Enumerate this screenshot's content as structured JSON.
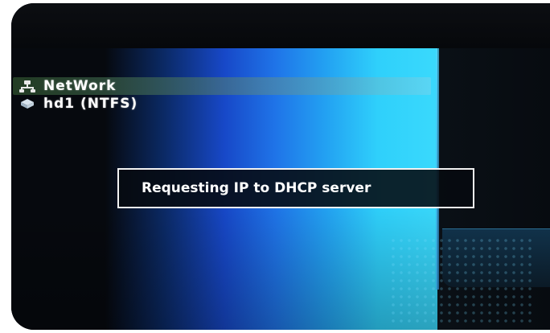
{
  "menu": {
    "items": [
      {
        "label": "NetWork",
        "icon": "network-icon",
        "selected": true
      },
      {
        "label": "hd1 (NTFS)",
        "icon": "hard-drive-icon",
        "selected": false
      }
    ]
  },
  "dialog": {
    "message": "Requesting IP to DHCP server"
  },
  "colors": {
    "background": "#07090d",
    "gradient_mid": "#1f74e8",
    "gradient_light": "#3ad9fc",
    "dialog_border": "#f2f2f2",
    "text": "#ffffff"
  }
}
